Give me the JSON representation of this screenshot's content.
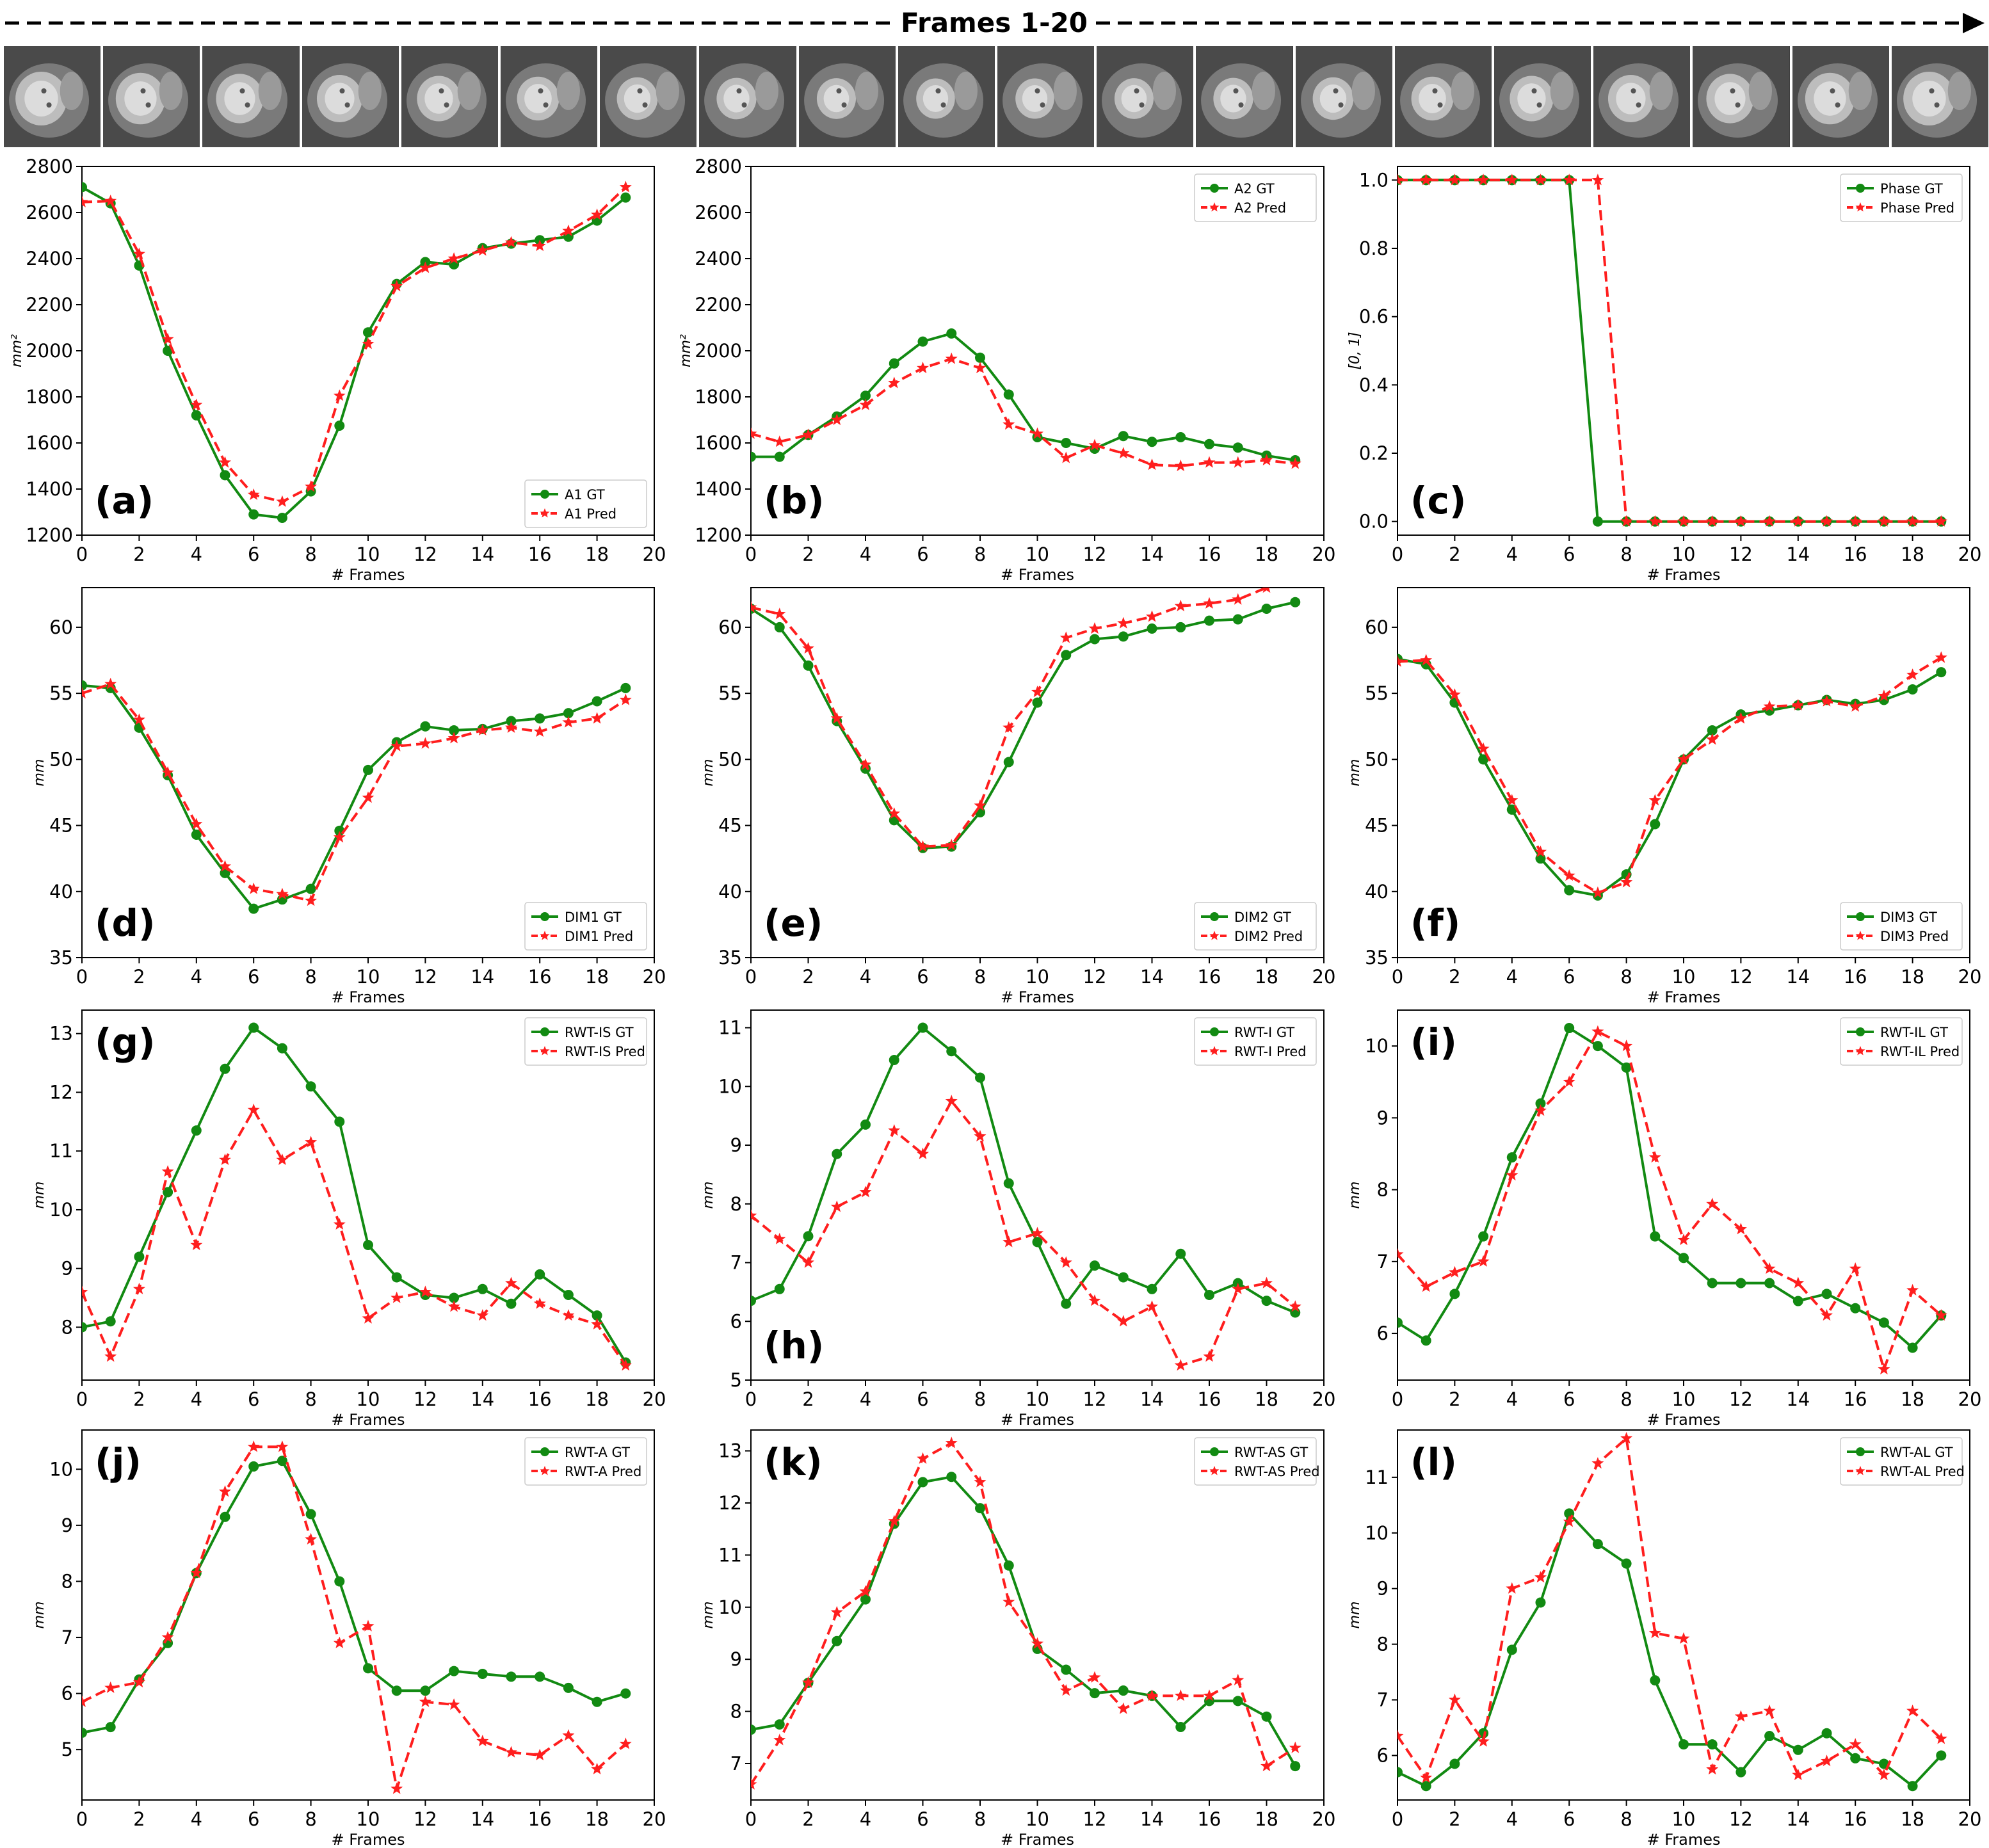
{
  "header": {
    "title": "Frames 1-20"
  },
  "filmstrip": {
    "frame_count": 20
  },
  "colors": {
    "gt": "#128a12",
    "pred": "#ff1e1e"
  },
  "chart_data": [
    {
      "type": "line",
      "panel_label": "(a)",
      "xlabel": "# Frames",
      "ylabel": "mm²",
      "xlim": [
        0,
        20
      ],
      "ylim": [
        1200,
        2800
      ],
      "xticks": [
        0,
        2,
        4,
        6,
        8,
        10,
        12,
        14,
        16,
        18,
        20
      ],
      "yticks": [
        1200,
        1400,
        1600,
        1800,
        2000,
        2200,
        2400,
        2600,
        2800
      ],
      "legend": "bottom-right",
      "x": [
        0,
        1,
        2,
        3,
        4,
        5,
        6,
        7,
        8,
        9,
        10,
        11,
        12,
        13,
        14,
        15,
        16,
        17,
        18,
        19
      ],
      "series": [
        {
          "name": "A1 GT",
          "values": [
            2710,
            2640,
            2370,
            2000,
            1720,
            1460,
            1290,
            1275,
            1390,
            1675,
            2080,
            2290,
            2385,
            2375,
            2445,
            2465,
            2480,
            2495,
            2565,
            2665
          ]
        },
        {
          "name": "A1 Pred",
          "values": [
            2645,
            2650,
            2420,
            2050,
            1765,
            1515,
            1375,
            1345,
            1410,
            1805,
            2030,
            2280,
            2360,
            2400,
            2435,
            2470,
            2455,
            2520,
            2590,
            2710
          ]
        }
      ]
    },
    {
      "type": "line",
      "panel_label": "(b)",
      "xlabel": "# Frames",
      "ylabel": "mm²",
      "xlim": [
        0,
        20
      ],
      "ylim": [
        1200,
        2800
      ],
      "xticks": [
        0,
        2,
        4,
        6,
        8,
        10,
        12,
        14,
        16,
        18,
        20
      ],
      "yticks": [
        1200,
        1400,
        1600,
        1800,
        2000,
        2200,
        2400,
        2600,
        2800
      ],
      "legend": "top-right",
      "x": [
        0,
        1,
        2,
        3,
        4,
        5,
        6,
        7,
        8,
        9,
        10,
        11,
        12,
        13,
        14,
        15,
        16,
        17,
        18,
        19
      ],
      "series": [
        {
          "name": "A2 GT",
          "values": [
            1540,
            1540,
            1635,
            1715,
            1805,
            1945,
            2040,
            2075,
            1970,
            1810,
            1625,
            1600,
            1575,
            1630,
            1605,
            1625,
            1595,
            1580,
            1545,
            1525
          ]
        },
        {
          "name": "A2 Pred",
          "values": [
            1640,
            1605,
            1635,
            1700,
            1765,
            1860,
            1925,
            1965,
            1925,
            1680,
            1640,
            1535,
            1590,
            1555,
            1505,
            1500,
            1515,
            1515,
            1525,
            1510
          ]
        }
      ]
    },
    {
      "type": "line",
      "panel_label": "(c)",
      "xlabel": "# Frames",
      "ylabel": "[0, 1]",
      "xlim": [
        0,
        20
      ],
      "ylim": [
        -0.04,
        1.04
      ],
      "xticks": [
        0,
        2,
        4,
        6,
        8,
        10,
        12,
        14,
        16,
        18,
        20
      ],
      "yticks": [
        0.0,
        0.2,
        0.4,
        0.6,
        0.8,
        1.0
      ],
      "ytick_decimals": 1,
      "legend": "top-right",
      "x": [
        0,
        1,
        2,
        3,
        4,
        5,
        6,
        7,
        8,
        9,
        10,
        11,
        12,
        13,
        14,
        15,
        16,
        17,
        18,
        19
      ],
      "series": [
        {
          "name": "Phase GT",
          "values": [
            1,
            1,
            1,
            1,
            1,
            1,
            1,
            0,
            0,
            0,
            0,
            0,
            0,
            0,
            0,
            0,
            0,
            0,
            0,
            0
          ]
        },
        {
          "name": "Phase Pred",
          "values": [
            1,
            1,
            1,
            1,
            1,
            1,
            1,
            1,
            0,
            0,
            0,
            0,
            0,
            0,
            0,
            0,
            0,
            0,
            0,
            0
          ]
        }
      ]
    },
    {
      "type": "line",
      "panel_label": "(d)",
      "xlabel": "# Frames",
      "ylabel": "mm",
      "xlim": [
        0,
        20
      ],
      "ylim": [
        35,
        63
      ],
      "xticks": [
        0,
        2,
        4,
        6,
        8,
        10,
        12,
        14,
        16,
        18,
        20
      ],
      "yticks": [
        35,
        40,
        45,
        50,
        55,
        60
      ],
      "legend": "bottom-right",
      "x": [
        0,
        1,
        2,
        3,
        4,
        5,
        6,
        7,
        8,
        9,
        10,
        11,
        12,
        13,
        14,
        15,
        16,
        17,
        18,
        19
      ],
      "series": [
        {
          "name": "DIM1 GT",
          "values": [
            55.6,
            55.4,
            52.4,
            48.8,
            44.3,
            41.4,
            38.7,
            39.4,
            40.2,
            44.6,
            49.2,
            51.3,
            52.5,
            52.2,
            52.3,
            52.9,
            53.1,
            53.5,
            54.4,
            55.4
          ]
        },
        {
          "name": "DIM1 Pred",
          "values": [
            55.0,
            55.7,
            53.0,
            49.0,
            45.1,
            41.9,
            40.2,
            39.8,
            39.3,
            44.1,
            47.1,
            51.0,
            51.2,
            51.6,
            52.2,
            52.4,
            52.1,
            52.8,
            53.1,
            54.5
          ]
        }
      ]
    },
    {
      "type": "line",
      "panel_label": "(e)",
      "xlabel": "# Frames",
      "ylabel": "mm",
      "xlim": [
        0,
        20
      ],
      "ylim": [
        35,
        63
      ],
      "xticks": [
        0,
        2,
        4,
        6,
        8,
        10,
        12,
        14,
        16,
        18,
        20
      ],
      "yticks": [
        35,
        40,
        45,
        50,
        55,
        60
      ],
      "legend": "bottom-right",
      "x": [
        0,
        1,
        2,
        3,
        4,
        5,
        6,
        7,
        8,
        9,
        10,
        11,
        12,
        13,
        14,
        15,
        16,
        17,
        18,
        19
      ],
      "series": [
        {
          "name": "DIM2 GT",
          "values": [
            61.4,
            60.0,
            57.1,
            52.9,
            49.3,
            45.4,
            43.3,
            43.4,
            46.0,
            49.8,
            54.3,
            57.9,
            59.1,
            59.3,
            59.9,
            60.0,
            60.5,
            60.6,
            61.4,
            61.9
          ]
        },
        {
          "name": "DIM2 Pred",
          "values": [
            61.5,
            61.0,
            58.4,
            53.1,
            49.6,
            45.9,
            43.4,
            43.5,
            46.5,
            52.4,
            55.1,
            59.2,
            59.9,
            60.3,
            60.8,
            61.6,
            61.8,
            62.1,
            63.0,
            64.0
          ]
        }
      ]
    },
    {
      "type": "line",
      "panel_label": "(f)",
      "xlabel": "# Frames",
      "ylabel": "mm",
      "xlim": [
        0,
        20
      ],
      "ylim": [
        35,
        63
      ],
      "xticks": [
        0,
        2,
        4,
        6,
        8,
        10,
        12,
        14,
        16,
        18,
        20
      ],
      "yticks": [
        35,
        40,
        45,
        50,
        55,
        60
      ],
      "legend": "bottom-right",
      "x": [
        0,
        1,
        2,
        3,
        4,
        5,
        6,
        7,
        8,
        9,
        10,
        11,
        12,
        13,
        14,
        15,
        16,
        17,
        18,
        19
      ],
      "series": [
        {
          "name": "DIM3 GT",
          "values": [
            57.6,
            57.2,
            54.3,
            50.0,
            46.2,
            42.5,
            40.1,
            39.7,
            41.3,
            45.1,
            50.0,
            52.2,
            53.4,
            53.7,
            54.1,
            54.5,
            54.2,
            54.5,
            55.3,
            56.6
          ]
        },
        {
          "name": "DIM3 Pred",
          "values": [
            57.4,
            57.5,
            54.9,
            50.8,
            46.9,
            43.0,
            41.2,
            39.9,
            40.7,
            46.9,
            50.0,
            51.5,
            53.1,
            54.0,
            54.1,
            54.4,
            54.0,
            54.8,
            56.4,
            57.7
          ]
        }
      ]
    },
    {
      "type": "line",
      "panel_label": "(g)",
      "xlabel": "# Frames",
      "ylabel": "mm",
      "xlim": [
        0,
        20
      ],
      "ylim": [
        7.1,
        13.4
      ],
      "xticks": [
        0,
        2,
        4,
        6,
        8,
        10,
        12,
        14,
        16,
        18,
        20
      ],
      "yticks": [
        8,
        9,
        10,
        11,
        12,
        13
      ],
      "legend": "top-right",
      "x": [
        0,
        1,
        2,
        3,
        4,
        5,
        6,
        7,
        8,
        9,
        10,
        11,
        12,
        13,
        14,
        15,
        16,
        17,
        18,
        19
      ],
      "series": [
        {
          "name": "RWT-IS GT",
          "values": [
            8.0,
            8.1,
            9.2,
            10.3,
            11.35,
            12.4,
            13.1,
            12.75,
            12.1,
            11.5,
            9.4,
            8.85,
            8.55,
            8.5,
            8.65,
            8.4,
            8.9,
            8.55,
            8.2,
            7.4
          ]
        },
        {
          "name": "RWT-IS Pred",
          "values": [
            8.6,
            7.5,
            8.65,
            10.65,
            9.4,
            10.85,
            11.7,
            10.85,
            11.15,
            9.75,
            8.15,
            8.5,
            8.6,
            8.35,
            8.2,
            8.75,
            8.4,
            8.2,
            8.05,
            7.35
          ]
        }
      ]
    },
    {
      "type": "line",
      "panel_label": "(h)",
      "xlabel": "# Frames",
      "ylabel": "mm",
      "xlim": [
        0,
        20
      ],
      "ylim": [
        5,
        11.3
      ],
      "xticks": [
        0,
        2,
        4,
        6,
        8,
        10,
        12,
        14,
        16,
        18,
        20
      ],
      "yticks": [
        5,
        6,
        7,
        8,
        9,
        10,
        11
      ],
      "legend": "top-right",
      "x": [
        0,
        1,
        2,
        3,
        4,
        5,
        6,
        7,
        8,
        9,
        10,
        11,
        12,
        13,
        14,
        15,
        16,
        17,
        18,
        19
      ],
      "series": [
        {
          "name": "RWT-I GT",
          "values": [
            6.35,
            6.55,
            7.45,
            8.85,
            9.35,
            10.45,
            11.0,
            10.6,
            10.15,
            8.35,
            7.35,
            6.3,
            6.95,
            6.75,
            6.55,
            7.15,
            6.45,
            6.65,
            6.35,
            6.15
          ]
        },
        {
          "name": "RWT-I Pred",
          "values": [
            7.8,
            7.4,
            7.0,
            7.95,
            8.2,
            9.25,
            8.85,
            9.75,
            9.15,
            7.35,
            7.5,
            7.0,
            6.35,
            6.0,
            6.25,
            5.25,
            5.4,
            6.55,
            6.65,
            6.25
          ]
        }
      ]
    },
    {
      "type": "line",
      "panel_label": "(i)",
      "xlabel": "# Frames",
      "ylabel": "mm",
      "xlim": [
        0,
        20
      ],
      "ylim": [
        5.35,
        10.5
      ],
      "xticks": [
        0,
        2,
        4,
        6,
        8,
        10,
        12,
        14,
        16,
        18,
        20
      ],
      "yticks": [
        6,
        7,
        8,
        9,
        10
      ],
      "legend": "top-right",
      "x": [
        0,
        1,
        2,
        3,
        4,
        5,
        6,
        7,
        8,
        9,
        10,
        11,
        12,
        13,
        14,
        15,
        16,
        17,
        18,
        19
      ],
      "series": [
        {
          "name": "RWT-IL GT",
          "values": [
            6.15,
            5.9,
            6.55,
            7.35,
            8.45,
            9.2,
            10.25,
            10.0,
            9.7,
            7.35,
            7.05,
            6.7,
            6.7,
            6.7,
            6.45,
            6.55,
            6.35,
            6.15,
            5.8,
            6.25
          ]
        },
        {
          "name": "RWT-IL Pred",
          "values": [
            7.1,
            6.65,
            6.85,
            7.0,
            8.2,
            9.1,
            9.5,
            10.2,
            10.0,
            8.45,
            7.3,
            7.8,
            7.45,
            6.9,
            6.7,
            6.25,
            6.9,
            5.5,
            6.6,
            6.25
          ]
        }
      ]
    },
    {
      "type": "line",
      "panel_label": "(j)",
      "xlabel": "# Frames",
      "ylabel": "mm",
      "xlim": [
        0,
        20
      ],
      "ylim": [
        4.1,
        10.7
      ],
      "xticks": [
        0,
        2,
        4,
        6,
        8,
        10,
        12,
        14,
        16,
        18,
        20
      ],
      "yticks": [
        5,
        6,
        7,
        8,
        9,
        10
      ],
      "legend": "top-right",
      "x": [
        0,
        1,
        2,
        3,
        4,
        5,
        6,
        7,
        8,
        9,
        10,
        11,
        12,
        13,
        14,
        15,
        16,
        17,
        18,
        19
      ],
      "series": [
        {
          "name": "RWT-A GT",
          "values": [
            5.3,
            5.4,
            6.25,
            6.9,
            8.15,
            9.15,
            10.05,
            10.15,
            9.2,
            8.0,
            6.45,
            6.05,
            6.05,
            6.4,
            6.35,
            6.3,
            6.3,
            6.1,
            5.85,
            6.0
          ]
        },
        {
          "name": "RWT-A Pred",
          "values": [
            5.85,
            6.1,
            6.2,
            7.0,
            8.15,
            9.6,
            10.4,
            10.4,
            8.75,
            6.9,
            7.2,
            4.3,
            5.85,
            5.8,
            5.15,
            4.95,
            4.9,
            5.25,
            4.65,
            5.1
          ]
        }
      ]
    },
    {
      "type": "line",
      "panel_label": "(k)",
      "xlabel": "# Frames",
      "ylabel": "mm",
      "xlim": [
        0,
        20
      ],
      "ylim": [
        6.3,
        13.4
      ],
      "xticks": [
        0,
        2,
        4,
        6,
        8,
        10,
        12,
        14,
        16,
        18,
        20
      ],
      "yticks": [
        7,
        8,
        9,
        10,
        11,
        12,
        13
      ],
      "legend": "top-right",
      "x": [
        0,
        1,
        2,
        3,
        4,
        5,
        6,
        7,
        8,
        9,
        10,
        11,
        12,
        13,
        14,
        15,
        16,
        17,
        18,
        19
      ],
      "series": [
        {
          "name": "RWT-AS GT",
          "values": [
            7.65,
            7.75,
            8.55,
            9.35,
            10.15,
            11.6,
            12.4,
            12.5,
            11.9,
            10.8,
            9.2,
            8.8,
            8.35,
            8.4,
            8.3,
            7.7,
            8.2,
            8.2,
            7.9,
            6.95
          ]
        },
        {
          "name": "RWT-AS Pred",
          "values": [
            6.6,
            7.45,
            8.55,
            9.9,
            10.3,
            11.65,
            12.85,
            13.15,
            12.4,
            10.1,
            9.3,
            8.4,
            8.65,
            8.05,
            8.3,
            8.3,
            8.3,
            8.6,
            6.95,
            7.3
          ]
        }
      ]
    },
    {
      "type": "line",
      "panel_label": "(l)",
      "xlabel": "# Frames",
      "ylabel": "mm",
      "xlim": [
        0,
        20
      ],
      "ylim": [
        5.2,
        11.85
      ],
      "xticks": [
        0,
        2,
        4,
        6,
        8,
        10,
        12,
        14,
        16,
        18,
        20
      ],
      "yticks": [
        6,
        7,
        8,
        9,
        10,
        11
      ],
      "legend": "top-right",
      "x": [
        0,
        1,
        2,
        3,
        4,
        5,
        6,
        7,
        8,
        9,
        10,
        11,
        12,
        13,
        14,
        15,
        16,
        17,
        18,
        19
      ],
      "series": [
        {
          "name": "RWT-AL GT",
          "values": [
            5.7,
            5.45,
            5.85,
            6.4,
            7.9,
            8.75,
            10.35,
            9.8,
            9.45,
            7.35,
            6.2,
            6.2,
            5.7,
            6.35,
            6.1,
            6.4,
            5.95,
            5.85,
            5.45,
            6.0
          ]
        },
        {
          "name": "RWT-AL Pred",
          "values": [
            6.35,
            5.6,
            7.0,
            6.25,
            9.0,
            9.2,
            10.2,
            11.25,
            11.7,
            8.2,
            8.1,
            5.75,
            6.7,
            6.8,
            5.65,
            5.9,
            6.2,
            5.65,
            6.8,
            6.3
          ]
        }
      ]
    }
  ]
}
